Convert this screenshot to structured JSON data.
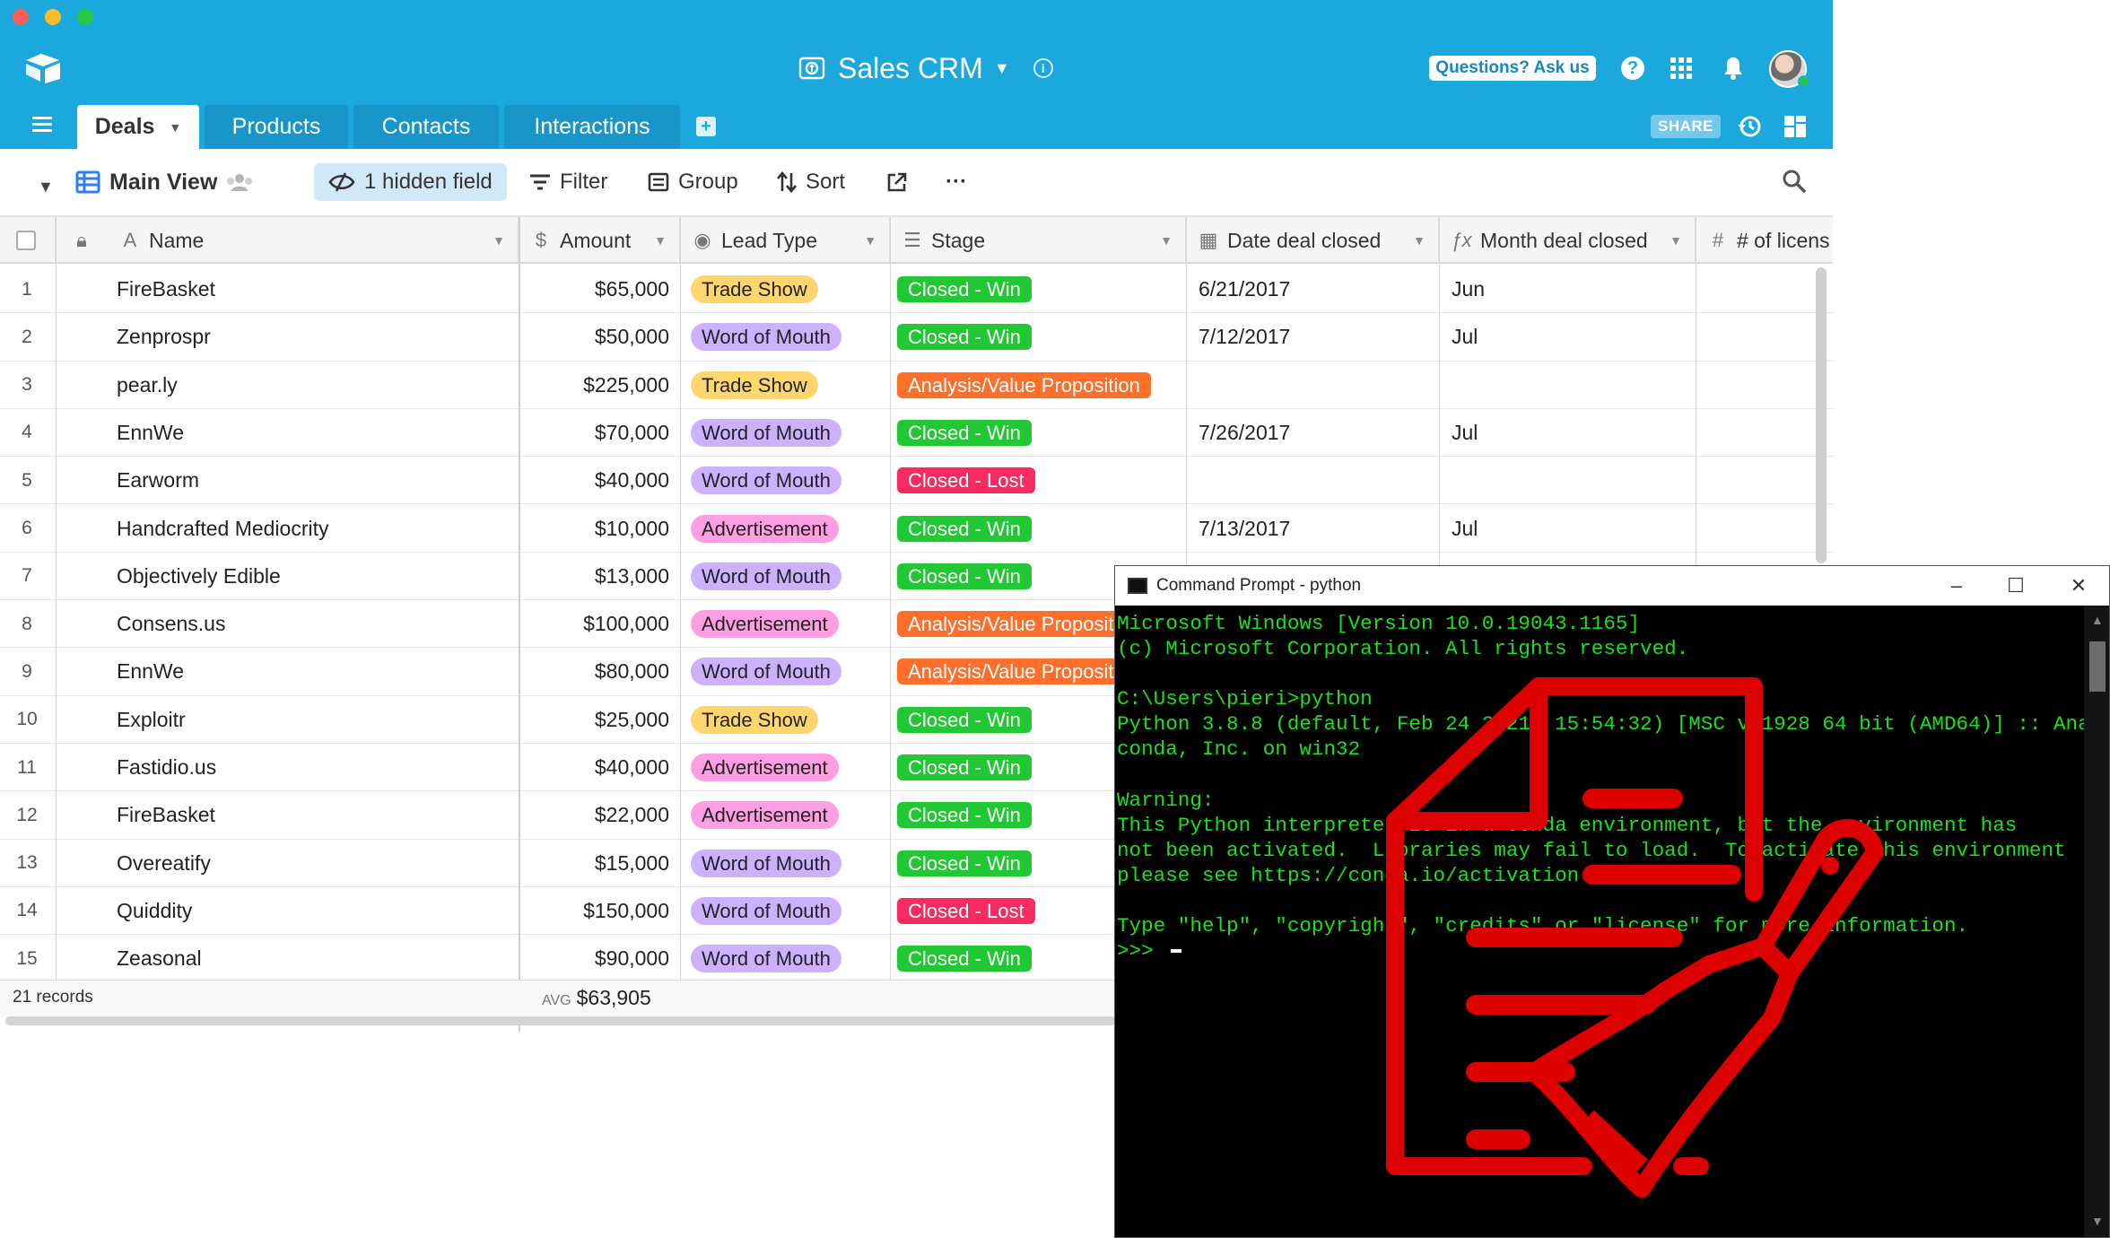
{
  "airtable": {
    "base_title": "Sales CRM",
    "ask_label": "Questions? Ask us",
    "share_label": "SHARE",
    "tabs": [
      {
        "label": "Deals",
        "active": true
      },
      {
        "label": "Products",
        "active": false
      },
      {
        "label": "Contacts",
        "active": false
      },
      {
        "label": "Interactions",
        "active": false
      }
    ],
    "toolbar": {
      "view_name": "Main View",
      "hidden_fields": "1 hidden field",
      "filter": "Filter",
      "group": "Group",
      "sort": "Sort"
    },
    "columns": [
      "Name",
      "Amount",
      "Lead Type",
      "Stage",
      "Date deal closed",
      "Month deal closed",
      "# of licens"
    ],
    "rows": [
      {
        "n": "1",
        "name": "FireBasket",
        "amount": "$65,000",
        "lead": "Trade Show",
        "stage": "Closed - Win",
        "date": "6/21/2017",
        "month": "Jun"
      },
      {
        "n": "2",
        "name": "Zenprospr",
        "amount": "$50,000",
        "lead": "Word of Mouth",
        "stage": "Closed - Win",
        "date": "7/12/2017",
        "month": "Jul"
      },
      {
        "n": "3",
        "name": "pear.ly",
        "amount": "$225,000",
        "lead": "Trade Show",
        "stage": "Analysis/Value Proposition",
        "date": "",
        "month": ""
      },
      {
        "n": "4",
        "name": "EnnWe",
        "amount": "$70,000",
        "lead": "Word of Mouth",
        "stage": "Closed - Win",
        "date": "7/26/2017",
        "month": "Jul"
      },
      {
        "n": "5",
        "name": "Earworm",
        "amount": "$40,000",
        "lead": "Word of Mouth",
        "stage": "Closed - Lost",
        "date": "",
        "month": ""
      },
      {
        "n": "6",
        "name": "Handcrafted Mediocrity",
        "amount": "$10,000",
        "lead": "Advertisement",
        "stage": "Closed - Win",
        "date": "7/13/2017",
        "month": "Jul"
      },
      {
        "n": "7",
        "name": "Objectively Edible",
        "amount": "$13,000",
        "lead": "Word of Mouth",
        "stage": "Closed - Win",
        "date": "",
        "month": ""
      },
      {
        "n": "8",
        "name": "Consens.us",
        "amount": "$100,000",
        "lead": "Advertisement",
        "stage": "Analysis/Value Proposition",
        "date": "",
        "month": ""
      },
      {
        "n": "9",
        "name": "EnnWe",
        "amount": "$80,000",
        "lead": "Word of Mouth",
        "stage": "Analysis/Value Proposition",
        "date": "",
        "month": ""
      },
      {
        "n": "10",
        "name": "Exploitr",
        "amount": "$25,000",
        "lead": "Trade Show",
        "stage": "Closed - Win",
        "date": "",
        "month": ""
      },
      {
        "n": "11",
        "name": "Fastidio.us",
        "amount": "$40,000",
        "lead": "Advertisement",
        "stage": "Closed - Win",
        "date": "",
        "month": ""
      },
      {
        "n": "12",
        "name": "FireBasket",
        "amount": "$22,000",
        "lead": "Advertisement",
        "stage": "Closed - Win",
        "date": "",
        "month": ""
      },
      {
        "n": "13",
        "name": "Overeatify",
        "amount": "$15,000",
        "lead": "Word of Mouth",
        "stage": "Closed - Win",
        "date": "",
        "month": ""
      },
      {
        "n": "14",
        "name": "Quiddity",
        "amount": "$150,000",
        "lead": "Word of Mouth",
        "stage": "Closed - Lost",
        "date": "",
        "month": ""
      },
      {
        "n": "15",
        "name": "Zeasonal",
        "amount": "$90,000",
        "lead": "Word of Mouth",
        "stage": "Closed - Win",
        "date": "",
        "month": ""
      }
    ],
    "footer": {
      "records": "21 records",
      "avg_label": "AVG",
      "avg_value": "$63,905"
    },
    "colors": {
      "header_bg": "#1ba8dd",
      "lead": {
        "Trade Show": "#ffd66e",
        "Word of Mouth": "#cdb0ff",
        "Advertisement": "#ff9ee2"
      },
      "stage": {
        "Closed - Win": "#20c933",
        "Closed - Lost": "#f82b60",
        "Analysis/Value Proposition": "#ff6f2c"
      }
    }
  },
  "cmd": {
    "title": "Command Prompt - python",
    "lines": [
      "Microsoft Windows [Version 10.0.19043.1165]",
      "(c) Microsoft Corporation. All rights reserved.",
      "",
      "C:\\Users\\pieri>python",
      "Python 3.8.8 (default, Feb 24 2021, 15:54:32) [MSC v.1928 64 bit (AMD64)] :: Ana",
      "conda, Inc. on win32",
      "",
      "Warning:",
      "This Python interpreter is in a conda environment, but the environment has",
      "not been activated.  Libraries may fail to load.  To activate this environment",
      "please see https://conda.io/activation",
      "",
      "Type \"help\", \"copyright\", \"credits\" or \"license\" for more information.",
      ">>> "
    ],
    "text_color": "#17e317"
  },
  "overlay": {
    "icon": "document-brush-icon",
    "color": "#dd0000"
  }
}
